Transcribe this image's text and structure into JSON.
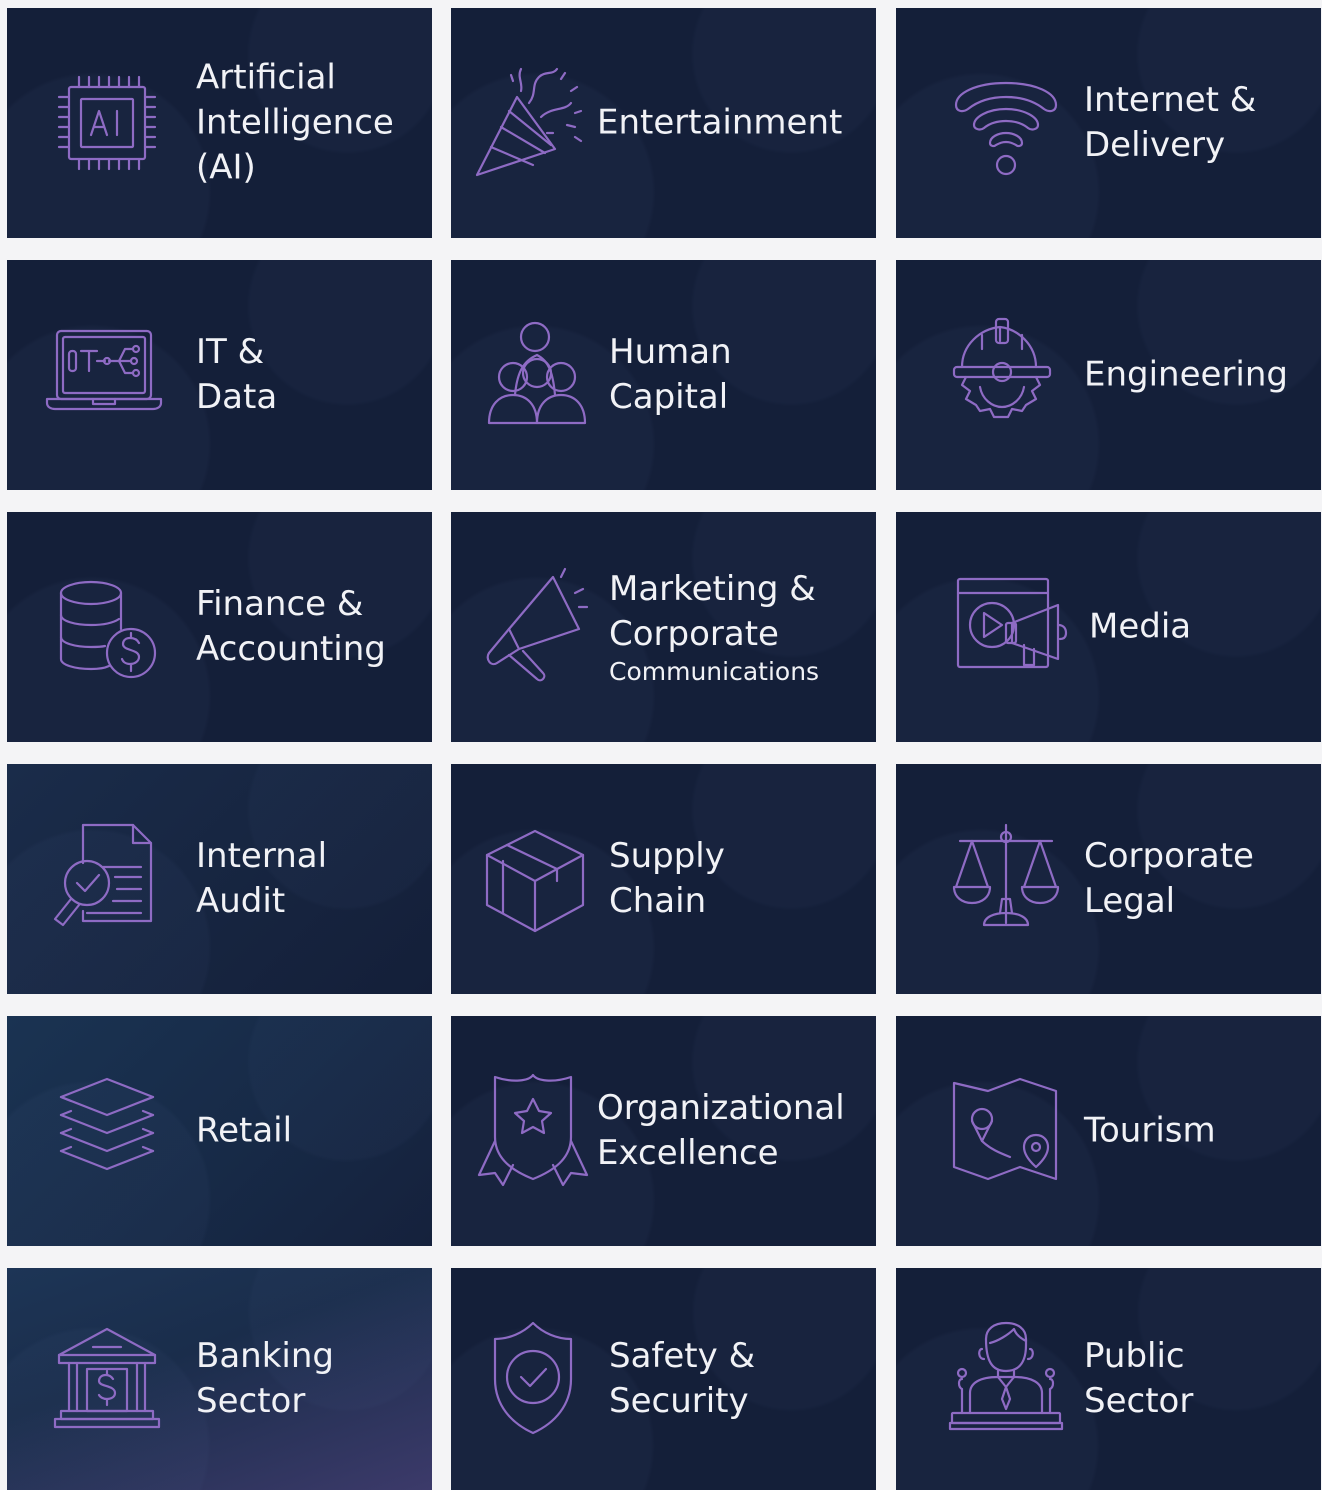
{
  "colors": {
    "tile_background": "#141f39",
    "icon_stroke": "#8e6bc4",
    "label_text": "#f1f2f6",
    "page_background": "#f4f4f6"
  },
  "tiles": [
    {
      "icon": "ai-chip-icon",
      "lines": [
        "Artificial",
        "Intelligence",
        "(AI)"
      ]
    },
    {
      "icon": "party-popper-icon",
      "lines": [
        "Entertainment"
      ]
    },
    {
      "icon": "wifi-icon",
      "lines": [
        "Internet &",
        "Delivery"
      ]
    },
    {
      "icon": "it-laptop-icon",
      "lines": [
        "IT &",
        "Data"
      ]
    },
    {
      "icon": "people-group-icon",
      "lines": [
        "Human",
        "Capital"
      ]
    },
    {
      "icon": "hardhat-gear-icon",
      "lines": [
        "Engineering"
      ]
    },
    {
      "icon": "coins-dollar-icon",
      "lines": [
        "Finance &",
        "Accounting"
      ]
    },
    {
      "icon": "megaphone-icon",
      "lines": [
        "Marketing &",
        "Corporate"
      ],
      "sub": "Communications"
    },
    {
      "icon": "video-megaphone-icon",
      "lines": [
        "Media"
      ]
    },
    {
      "icon": "document-magnifier-icon",
      "lines": [
        "Internal",
        "Audit"
      ]
    },
    {
      "icon": "box-icon",
      "lines": [
        "Supply",
        "Chain"
      ]
    },
    {
      "icon": "scales-icon",
      "lines": [
        "Corporate",
        "Legal"
      ]
    },
    {
      "icon": "layers-icon",
      "lines": [
        "Retail"
      ]
    },
    {
      "icon": "shield-star-badge-icon",
      "lines": [
        "Organizational",
        "Excellence"
      ]
    },
    {
      "icon": "map-route-icon",
      "lines": [
        "Tourism"
      ]
    },
    {
      "icon": "bank-building-icon",
      "lines": [
        "Banking",
        "Sector"
      ]
    },
    {
      "icon": "shield-check-icon",
      "lines": [
        "Safety &",
        "Security"
      ]
    },
    {
      "icon": "speaker-podium-icon",
      "lines": [
        "Public",
        "Sector"
      ]
    }
  ]
}
